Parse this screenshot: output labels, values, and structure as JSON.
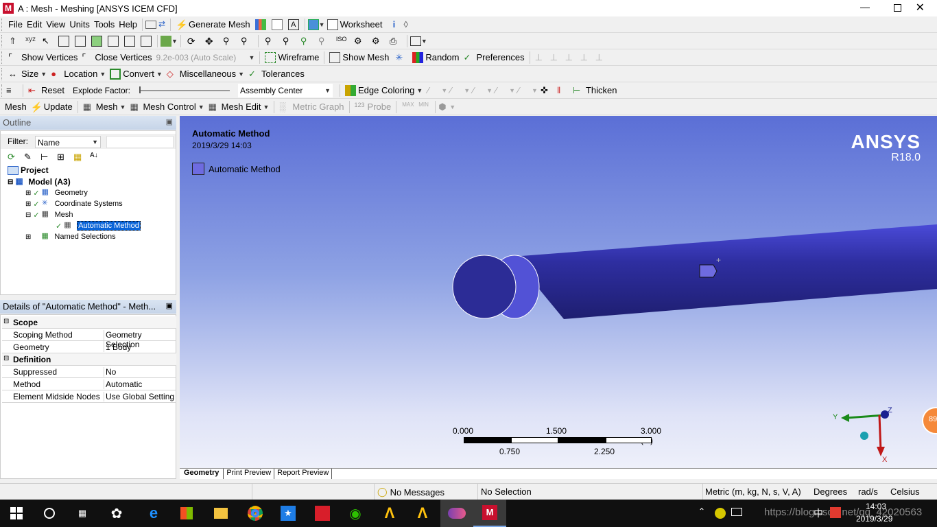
{
  "window": {
    "title": "A : Mesh - Meshing [ANSYS ICEM CFD]",
    "app_icon": "M"
  },
  "menu": [
    "File",
    "Edit",
    "View",
    "Units",
    "Tools",
    "Help"
  ],
  "toolbar1": {
    "generate_mesh": "Generate Mesh",
    "worksheet": "Worksheet"
  },
  "toolbar3": {
    "show_vertices": "Show Vertices",
    "close_vertices": "Close Vertices",
    "scale": "9.2e-003 (Auto Scale)",
    "wireframe": "Wireframe",
    "show_mesh": "Show Mesh",
    "random": "Random",
    "preferences": "Preferences"
  },
  "toolbar4": {
    "size": "Size",
    "location": "Location",
    "convert": "Convert",
    "misc": "Miscellaneous",
    "tolerances": "Tolerances"
  },
  "toolbar5": {
    "reset": "Reset",
    "explode_factor": "Explode Factor:",
    "assembly_center": "Assembly Center",
    "edge_coloring": "Edge Coloring",
    "thicken": "Thicken"
  },
  "toolbar6": {
    "mesh": "Mesh",
    "update": "Update",
    "mesh_menu": "Mesh",
    "mesh_control": "Mesh Control",
    "mesh_edit": "Mesh Edit",
    "metric_graph": "Metric Graph",
    "probe": "Probe"
  },
  "outline": {
    "title": "Outline",
    "pin": "⌂",
    "filter_label": "Filter:",
    "filter_value": "Name",
    "tree": {
      "project": "Project",
      "model": "Model (A3)",
      "geometry": "Geometry",
      "coord": "Coordinate Systems",
      "mesh": "Mesh",
      "auto": "Automatic Method",
      "named": "Named Selections"
    }
  },
  "details": {
    "title": "Details of \"Automatic Method\" - Meth...",
    "scope": "Scope",
    "scoping_method_k": "Scoping Method",
    "scoping_method_v": "Geometry Selection",
    "geometry_k": "Geometry",
    "geometry_v": "1 Body",
    "definition": "Definition",
    "suppressed_k": "Suppressed",
    "suppressed_v": "No",
    "method_k": "Method",
    "method_v": "Automatic",
    "midside_k": "Element Midside Nodes",
    "midside_v": "Use Global Setting"
  },
  "viewport": {
    "heading": "Automatic Method",
    "date": "2019/3/29 14:03",
    "legend": "Automatic Method",
    "brand": "ANSYS",
    "version": "R18.0",
    "scale_top": [
      "0.000",
      "1.500",
      "3.000 (m)"
    ],
    "scale_bottom": [
      "0.750",
      "2.250"
    ],
    "axis": {
      "y": "Y",
      "z": "Z",
      "x": "X"
    },
    "badge": "89",
    "colors": {
      "bg_top": "#5b6fd6",
      "bg_bottom": "#e9ebf8",
      "body": "#2a2a8a",
      "legend": "#6e6be0"
    }
  },
  "view_tabs": [
    "Geometry",
    "Print Preview",
    "Report Preview"
  ],
  "status": {
    "messages": "No Messages",
    "selection": "No Selection",
    "units": "Metric (m, kg, N, s, V, A)",
    "angle": "Degrees",
    "rate": "rad/s",
    "temp": "Celsius"
  },
  "taskbar": {
    "time": "14:03",
    "date": "2019/3/29",
    "watermark": "https://blog.csdn.net/qq_42020563",
    "ime": "中"
  }
}
